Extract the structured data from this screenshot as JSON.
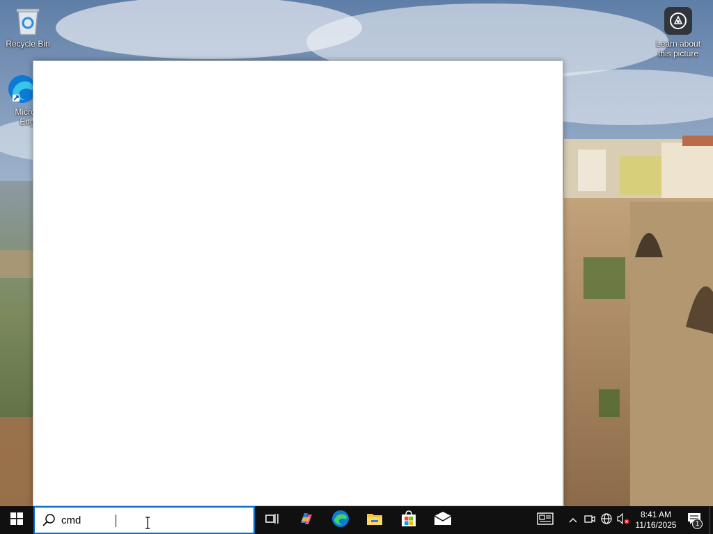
{
  "desktop": {
    "icons": [
      {
        "label": "Recycle Bin",
        "icon": "recycle-bin-icon"
      },
      {
        "label": "Micros Edg",
        "icon": "edge-icon"
      },
      {
        "label": "Learn about this picture",
        "icon": "camera-icon"
      }
    ]
  },
  "search": {
    "query": "cmd",
    "icon": "search-icon",
    "accent": "#0a6cd4"
  },
  "taskbar": {
    "start_icon": "windows-logo-icon",
    "apps": [
      {
        "name": "Task View",
        "icon": "task-view-icon"
      },
      {
        "name": "Copilot",
        "icon": "copilot-icon"
      },
      {
        "name": "Microsoft Edge",
        "icon": "edge-icon"
      },
      {
        "name": "File Explorer",
        "icon": "folder-icon"
      },
      {
        "name": "Microsoft Store",
        "icon": "store-icon"
      },
      {
        "name": "Mail",
        "icon": "mail-icon"
      }
    ],
    "tray": {
      "icons": [
        "news-icon",
        "chevron-up-icon",
        "meet-now-icon",
        "network-icon",
        "volume-muted-icon"
      ],
      "time": "8:41 AM",
      "date": "11/16/2025",
      "notification_count": "1"
    }
  }
}
